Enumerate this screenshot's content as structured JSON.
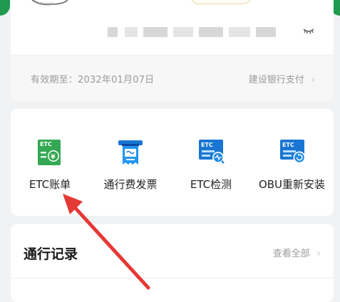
{
  "top_card": {
    "validity_text": "有效期至：2032年01月07日",
    "payment_text": "建设银行支付",
    "payment_chevron": "chevron-right-icon"
  },
  "services": [
    {
      "label": "ETC账单",
      "icon": "etc-bill-icon",
      "badge": "ETC"
    },
    {
      "label": "通行费发票",
      "icon": "invoice-icon"
    },
    {
      "label": "ETC检测",
      "icon": "etc-check-icon",
      "badge": "ETC"
    },
    {
      "label": "OBU重新安装",
      "icon": "obu-reinstall-icon",
      "badge": "ETC"
    }
  ],
  "records": {
    "title": "通行记录",
    "view_all": "查看全部"
  },
  "colors": {
    "brand_green": "#1f9a4f",
    "icon_green": "#2fa84f",
    "icon_blue": "#1976d2",
    "annotation_red": "#e53935"
  }
}
